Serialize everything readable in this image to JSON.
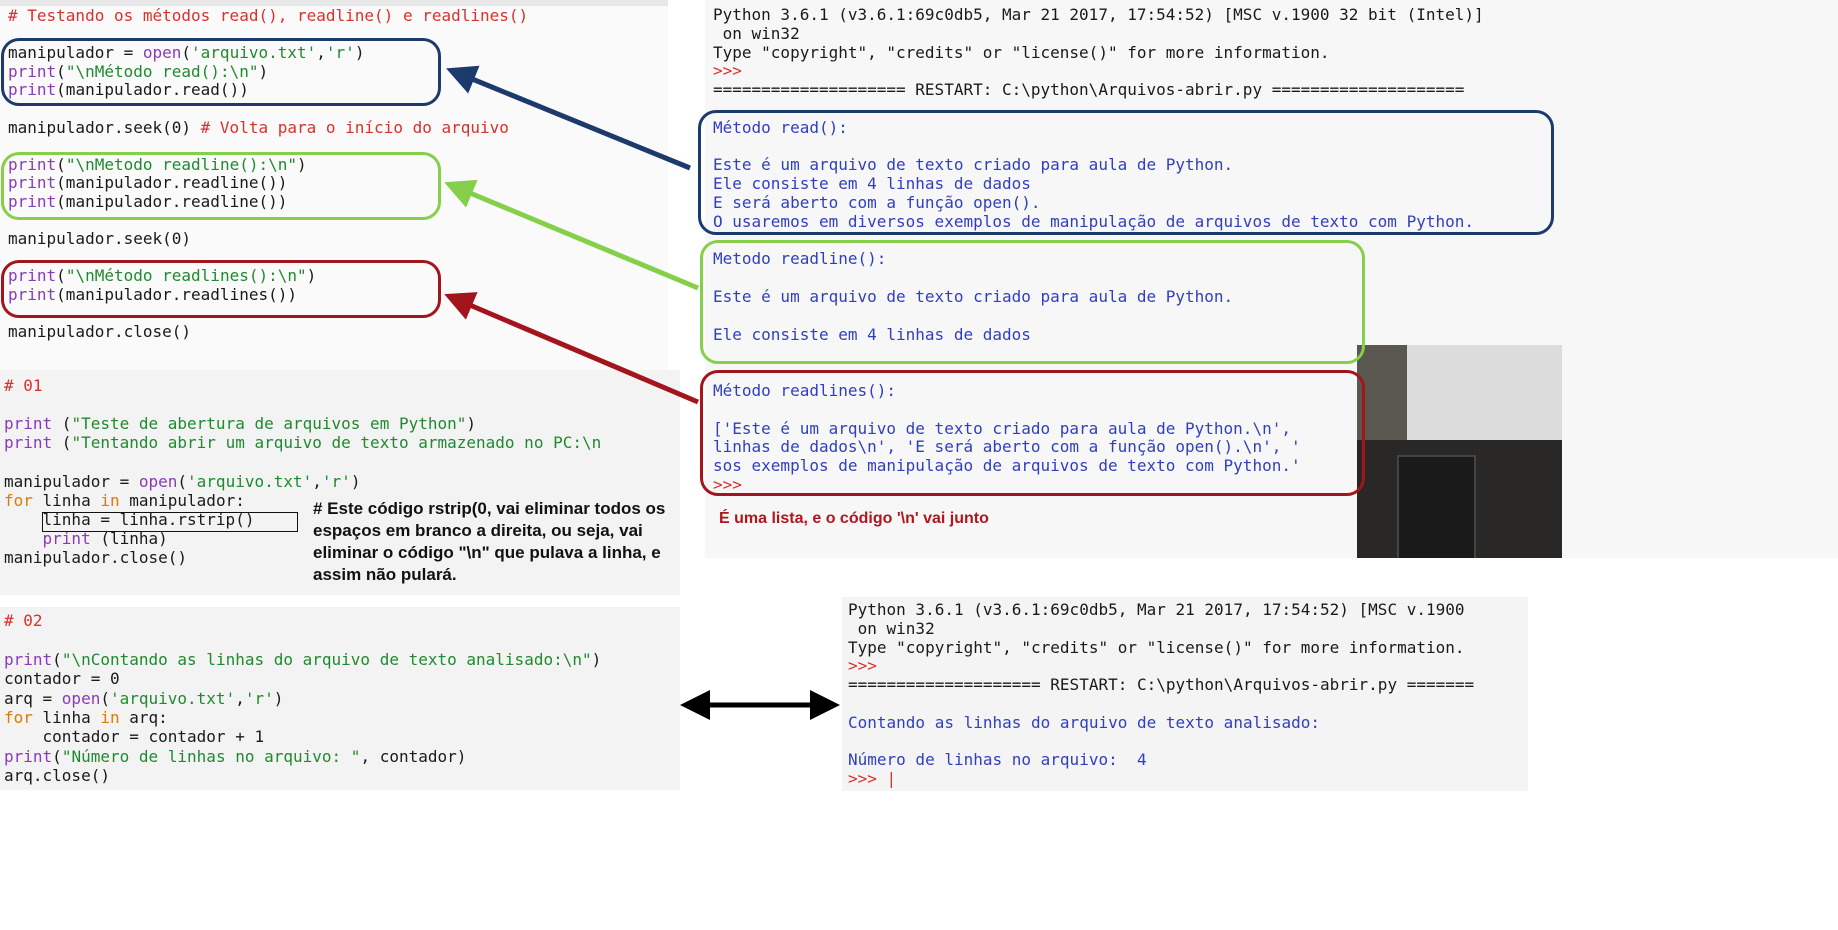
{
  "editor_top": {
    "lines": [
      {
        "parts": [
          {
            "t": "# Testando os métodos read(), readline() e readlines()",
            "c": "kw-com"
          }
        ]
      },
      {
        "parts": []
      },
      {
        "parts": [
          {
            "t": "manipulador = ",
            "c": ""
          },
          {
            "t": "open",
            "c": "kw-fn"
          },
          {
            "t": "(",
            "c": ""
          },
          {
            "t": "'arquivo.txt'",
            "c": "kw-str"
          },
          {
            "t": ",",
            "c": ""
          },
          {
            "t": "'r'",
            "c": "kw-str"
          },
          {
            "t": ")",
            "c": ""
          }
        ]
      },
      {
        "parts": [
          {
            "t": "print",
            "c": "kw-fn"
          },
          {
            "t": "(",
            "c": ""
          },
          {
            "t": "\"\\nMétodo read():\\n\"",
            "c": "kw-str"
          },
          {
            "t": ")",
            "c": ""
          }
        ]
      },
      {
        "parts": [
          {
            "t": "print",
            "c": "kw-fn"
          },
          {
            "t": "(manipulador.read())",
            "c": ""
          }
        ]
      },
      {
        "parts": []
      },
      {
        "parts": [
          {
            "t": "manipulador.seek(0) ",
            "c": ""
          },
          {
            "t": "# Volta para o início do arquivo",
            "c": "kw-com"
          }
        ]
      },
      {
        "parts": []
      },
      {
        "parts": [
          {
            "t": "print",
            "c": "kw-fn"
          },
          {
            "t": "(",
            "c": ""
          },
          {
            "t": "\"\\nMetodo readline():\\n\"",
            "c": "kw-str"
          },
          {
            "t": ")",
            "c": ""
          }
        ]
      },
      {
        "parts": [
          {
            "t": "print",
            "c": "kw-fn"
          },
          {
            "t": "(manipulador.readline())",
            "c": ""
          }
        ]
      },
      {
        "parts": [
          {
            "t": "print",
            "c": "kw-fn"
          },
          {
            "t": "(manipulador.readline())",
            "c": ""
          }
        ]
      },
      {
        "parts": []
      },
      {
        "parts": [
          {
            "t": "manipulador.seek(0)",
            "c": ""
          }
        ]
      },
      {
        "parts": []
      },
      {
        "parts": [
          {
            "t": "print",
            "c": "kw-fn"
          },
          {
            "t": "(",
            "c": ""
          },
          {
            "t": "\"\\nMétodo readlines():\\n\"",
            "c": "kw-str"
          },
          {
            "t": ")",
            "c": ""
          }
        ]
      },
      {
        "parts": [
          {
            "t": "print",
            "c": "kw-fn"
          },
          {
            "t": "(manipulador.readlines())",
            "c": ""
          }
        ]
      },
      {
        "parts": []
      },
      {
        "parts": [
          {
            "t": "manipulador.close()",
            "c": ""
          }
        ]
      }
    ]
  },
  "editor_01": {
    "lines": [
      {
        "parts": [
          {
            "t": "# 01",
            "c": "kw-com"
          }
        ]
      },
      {
        "parts": []
      },
      {
        "parts": [
          {
            "t": "print",
            "c": "kw-fn"
          },
          {
            "t": " (",
            "c": ""
          },
          {
            "t": "\"Teste de abertura de arquivos em Python\"",
            "c": "kw-str"
          },
          {
            "t": ")",
            "c": ""
          }
        ]
      },
      {
        "parts": [
          {
            "t": "print",
            "c": "kw-fn"
          },
          {
            "t": " (",
            "c": ""
          },
          {
            "t": "\"Tentando abrir um arquivo de texto armazenado no PC:\\n",
            "c": "kw-str"
          }
        ]
      },
      {
        "parts": []
      },
      {
        "parts": [
          {
            "t": "manipulador = ",
            "c": ""
          },
          {
            "t": "open",
            "c": "kw-fn"
          },
          {
            "t": "(",
            "c": ""
          },
          {
            "t": "'arquivo.txt'",
            "c": "kw-str"
          },
          {
            "t": ",",
            "c": ""
          },
          {
            "t": "'r'",
            "c": "kw-str"
          },
          {
            "t": ")",
            "c": ""
          }
        ]
      },
      {
        "parts": [
          {
            "t": "for",
            "c": "kw-key"
          },
          {
            "t": " linha ",
            "c": ""
          },
          {
            "t": "in",
            "c": "kw-key"
          },
          {
            "t": " manipulador:",
            "c": ""
          }
        ]
      },
      {
        "parts": [
          {
            "t": "    linha = linha.rstrip()",
            "c": ""
          }
        ]
      },
      {
        "parts": [
          {
            "t": "    ",
            "c": ""
          },
          {
            "t": "print",
            "c": "kw-fn"
          },
          {
            "t": " (linha)",
            "c": ""
          }
        ]
      },
      {
        "parts": [
          {
            "t": "manipulador.close()",
            "c": ""
          }
        ]
      }
    ],
    "note": "# Este código rstrip(0, vai eliminar todos os\nespaços em branco a direita, ou seja, vai\neliminar o código \"\\n\" que pulava a linha, e\nassim não pulará."
  },
  "editor_02": {
    "lines": [
      {
        "parts": [
          {
            "t": "# 02",
            "c": "kw-com"
          }
        ]
      },
      {
        "parts": []
      },
      {
        "parts": [
          {
            "t": "print",
            "c": "kw-fn"
          },
          {
            "t": "(",
            "c": ""
          },
          {
            "t": "\"\\nContando as linhas do arquivo de texto analisado:\\n\"",
            "c": "kw-str"
          },
          {
            "t": ")",
            "c": ""
          }
        ]
      },
      {
        "parts": [
          {
            "t": "contador = 0",
            "c": ""
          }
        ]
      },
      {
        "parts": [
          {
            "t": "arq = ",
            "c": ""
          },
          {
            "t": "open",
            "c": "kw-fn"
          },
          {
            "t": "(",
            "c": ""
          },
          {
            "t": "'arquivo.txt'",
            "c": "kw-str"
          },
          {
            "t": ",",
            "c": ""
          },
          {
            "t": "'r'",
            "c": "kw-str"
          },
          {
            "t": ")",
            "c": ""
          }
        ]
      },
      {
        "parts": [
          {
            "t": "for",
            "c": "kw-key"
          },
          {
            "t": " linha ",
            "c": ""
          },
          {
            "t": "in",
            "c": "kw-key"
          },
          {
            "t": " arq:",
            "c": ""
          }
        ]
      },
      {
        "parts": [
          {
            "t": "    contador = contador + 1",
            "c": ""
          }
        ]
      },
      {
        "parts": [
          {
            "t": "print",
            "c": "kw-fn"
          },
          {
            "t": "(",
            "c": ""
          },
          {
            "t": "\"Número de linhas no arquivo: \"",
            "c": "kw-str"
          },
          {
            "t": ", contador)",
            "c": ""
          }
        ]
      },
      {
        "parts": [
          {
            "t": "arq.close()",
            "c": ""
          }
        ]
      }
    ]
  },
  "shell_top": {
    "lines": [
      {
        "parts": [
          {
            "t": "Python 3.6.1 (v3.6.1:69c0db5, Mar 21 2017, 17:54:52) [MSC v.1900 32 bit (Intel)]",
            "c": ""
          }
        ]
      },
      {
        "parts": [
          {
            "t": " on win32",
            "c": ""
          }
        ]
      },
      {
        "parts": [
          {
            "t": "Type \"copyright\", \"credits\" or \"license()\" for more information.",
            "c": ""
          }
        ]
      },
      {
        "parts": [
          {
            "t": ">>>",
            "c": "kw-com"
          }
        ]
      },
      {
        "parts": [
          {
            "t": "==================== RESTART: C:\\python\\Arquivos-abrir.py ====================",
            "c": ""
          }
        ]
      },
      {
        "parts": []
      },
      {
        "parts": [
          {
            "t": "Método read():",
            "c": "kw-out"
          }
        ]
      },
      {
        "parts": []
      },
      {
        "parts": [
          {
            "t": "Este é um arquivo de texto criado para aula de Python.",
            "c": "kw-out"
          }
        ]
      },
      {
        "parts": [
          {
            "t": "Ele consiste em 4 linhas de dados",
            "c": "kw-out"
          }
        ]
      },
      {
        "parts": [
          {
            "t": "E será aberto com a função open().",
            "c": "kw-out"
          }
        ]
      },
      {
        "parts": [
          {
            "t": "O usaremos em diversos exemplos de manipulação de arquivos de texto com Python.",
            "c": "kw-out"
          }
        ]
      },
      {
        "parts": []
      },
      {
        "parts": [
          {
            "t": "Metodo readline():",
            "c": "kw-out"
          }
        ]
      },
      {
        "parts": []
      },
      {
        "parts": [
          {
            "t": "Este é um arquivo de texto criado para aula de Python.",
            "c": "kw-out"
          }
        ]
      },
      {
        "parts": []
      },
      {
        "parts": [
          {
            "t": "Ele consiste em 4 linhas de dados",
            "c": "kw-out"
          }
        ]
      },
      {
        "parts": []
      },
      {
        "parts": []
      },
      {
        "parts": [
          {
            "t": "Método readlines():",
            "c": "kw-out"
          }
        ]
      },
      {
        "parts": []
      },
      {
        "parts": [
          {
            "t": "['Este é um arquivo de texto criado para aula de Python.\\n', ",
            "c": "kw-out"
          }
        ]
      },
      {
        "parts": [
          {
            "t": "linhas de dados\\n', 'E será aberto com a função open().\\n', '",
            "c": "kw-out"
          }
        ]
      },
      {
        "parts": [
          {
            "t": "sos exemplos de manipulação de arquivos de texto com Python.'",
            "c": "kw-out"
          }
        ]
      },
      {
        "parts": [
          {
            "t": ">>>",
            "c": "kw-com"
          }
        ]
      }
    ],
    "note": "É uma lista, e o código '\\n' vai junto"
  },
  "shell_bottom": {
    "lines": [
      {
        "parts": [
          {
            "t": "Python 3.6.1 (v3.6.1:69c0db5, Mar 21 2017, 17:54:52) [MSC v.1900",
            "c": ""
          }
        ]
      },
      {
        "parts": [
          {
            "t": " on win32",
            "c": ""
          }
        ]
      },
      {
        "parts": [
          {
            "t": "Type \"copyright\", \"credits\" or \"license()\" for more information.",
            "c": ""
          }
        ]
      },
      {
        "parts": [
          {
            "t": ">>>",
            "c": "kw-com"
          }
        ]
      },
      {
        "parts": [
          {
            "t": "==================== RESTART: C:\\python\\Arquivos-abrir.py =======",
            "c": ""
          }
        ]
      },
      {
        "parts": []
      },
      {
        "parts": [
          {
            "t": "Contando as linhas do arquivo de texto analisado:",
            "c": "kw-out"
          }
        ]
      },
      {
        "parts": []
      },
      {
        "parts": [
          {
            "t": "Número de linhas no arquivo:  4",
            "c": "kw-out"
          }
        ]
      },
      {
        "parts": [
          {
            "t": ">>> |",
            "c": "kw-com"
          }
        ]
      }
    ]
  },
  "colors": {
    "blue_box": "#1c3a6b",
    "green_box": "#86cf4a",
    "red_box": "#a3151c"
  }
}
